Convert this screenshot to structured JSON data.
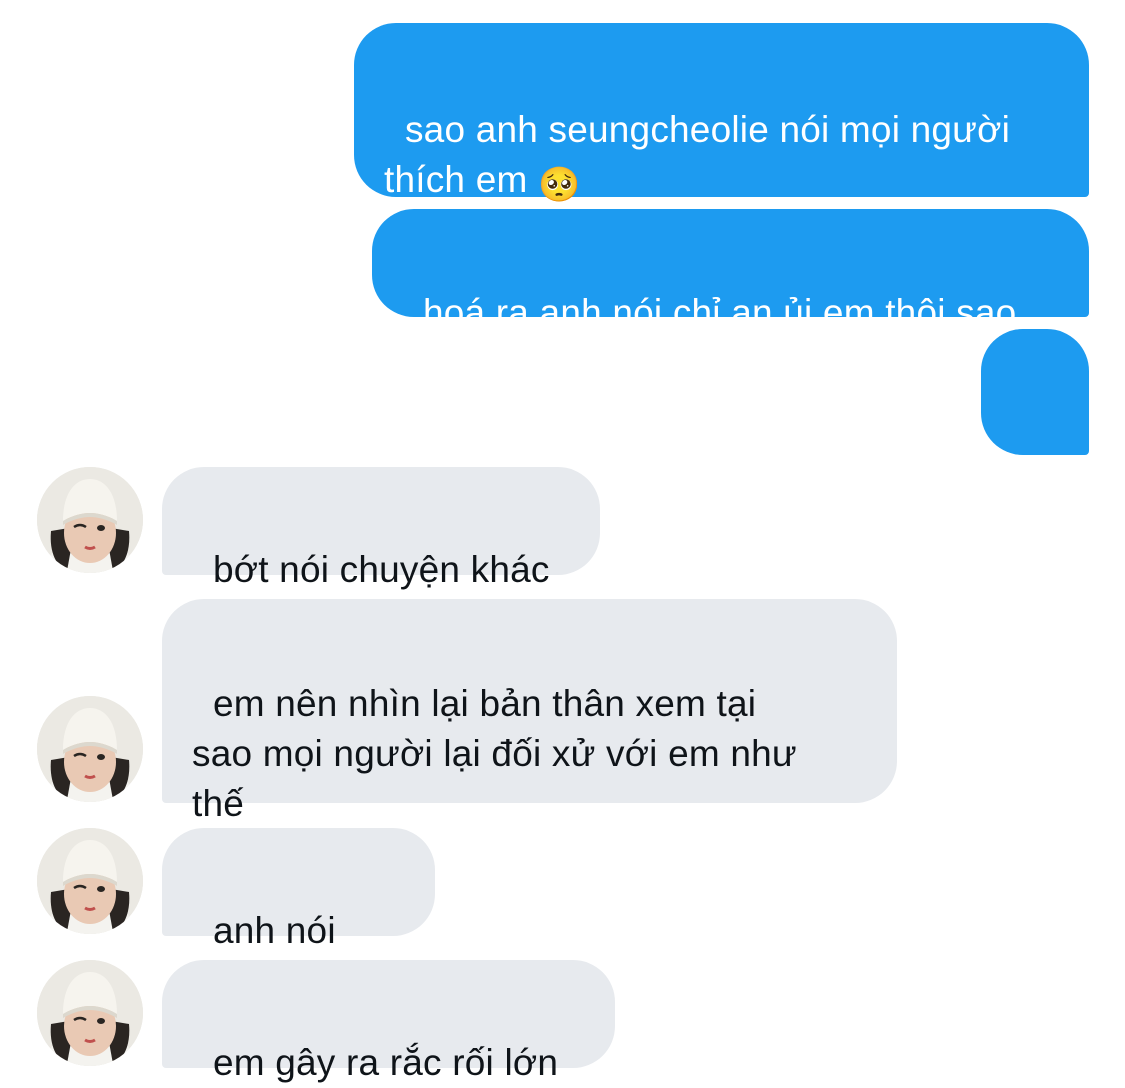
{
  "conversation": {
    "colors": {
      "sent_bubble": "#1d9bf0",
      "received_bubble": "#e7eaee",
      "sent_text": "#ffffff",
      "received_text": "#0f1419"
    },
    "sent": [
      {
        "text": "sao anh seungcheolie nói mọi người\nthích em ",
        "emoji": "🥺"
      },
      {
        "text": "hoá ra anh nói chỉ an ủi em thôi sao"
      },
      {
        "text": "",
        "emoji": "😭"
      }
    ],
    "received": [
      {
        "text": "bớt nói chuyện khác",
        "avatar_icon": "user-avatar-icon"
      },
      {
        "text": "em nên nhìn lại bản thân xem tại\nsao mọi người lại đối xử với em như\nthế",
        "avatar_icon": "user-avatar-icon"
      },
      {
        "text": "anh nói này",
        "avatar_icon": "user-avatar-icon"
      },
      {
        "text": "em gây ra rắc rối lớn",
        "avatar_icon": "user-avatar-icon"
      }
    ]
  }
}
